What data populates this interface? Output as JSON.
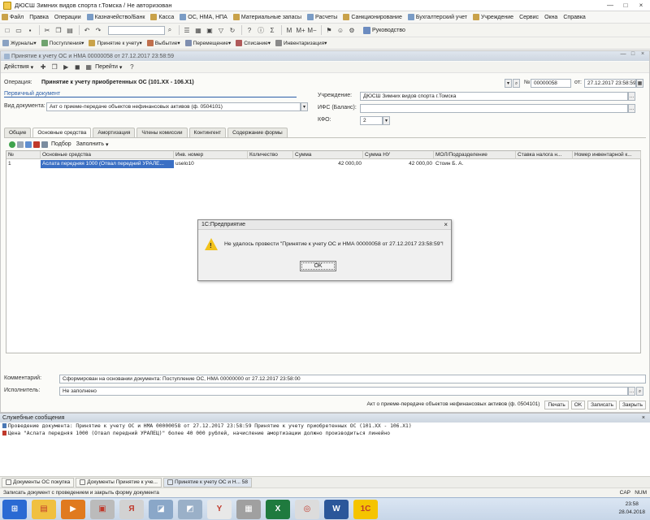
{
  "window": {
    "title": "ДЮСШ Зимних видов спорта г.Томска / Не авторизован",
    "controls": [
      "—",
      "□",
      "×"
    ]
  },
  "menu": [
    {
      "label": "Файл",
      "icon": "file-icon"
    },
    {
      "label": "Правка",
      "icon": null
    },
    {
      "label": "Операции",
      "icon": null
    },
    {
      "label": "Казначейство/Банк",
      "icon": "bank-icon"
    },
    {
      "label": "Касса",
      "icon": "cash-icon"
    },
    {
      "label": "ОС, НМА, НПА",
      "icon": "assets-icon"
    },
    {
      "label": "Материальные запасы",
      "icon": "materials-icon"
    },
    {
      "label": "Расчеты",
      "icon": "calc-icon"
    },
    {
      "label": "Санкционирование",
      "icon": "sanction-icon"
    },
    {
      "label": "Бухгалтерский учет",
      "icon": "ledger-icon"
    },
    {
      "label": "Учреждение",
      "icon": "org-icon"
    },
    {
      "label": "Сервис",
      "icon": null
    },
    {
      "label": "Окна",
      "icon": null
    },
    {
      "label": "Справка",
      "icon": null
    }
  ],
  "toolbar2": [
    {
      "label": "Журналы",
      "icon": "journal-icon"
    },
    {
      "label": "Поступления",
      "icon": "income-icon"
    },
    {
      "label": "Принятие к учету",
      "icon": "accept-icon"
    },
    {
      "label": "Выбытие",
      "icon": "disposal-icon"
    },
    {
      "label": "Перемещение",
      "icon": "move-icon"
    },
    {
      "label": "Списание",
      "icon": "writeoff-icon"
    },
    {
      "label": "Инвентаризация",
      "icon": "inventory-icon"
    }
  ],
  "toolbar1_right": {
    "text": "Руководство",
    "sigma": "Σ",
    "m_btn": "M",
    "mplus": "M+",
    "mminus": "M−"
  },
  "doc": {
    "title": "Принятие к учету ОС и НМА 00000058 от 27.12.2017 23:58:59",
    "toolbar": {
      "actions": "Действия",
      "go": "Перейти",
      "help": "?"
    },
    "operation_label": "Операция:",
    "operation_value": "Принятие к учету приобретенных ОС (101.ХХ - 106.Х1)",
    "number_label": "№",
    "number": "00000058",
    "date_label": "от:",
    "date": "27.12.2017 23:58:59",
    "primary_doc": "Первичный документ",
    "kind_label": "Вид документа:",
    "kind_value": "Акт о приеме-передаче объектов нефинансовых активов (ф. 0504101)",
    "institution_label": "Учреждение:",
    "institution_value": "ДЮСШ Зимних видов спорта г.Томска",
    "ifs_label": "ИФС (Баланс):",
    "ifs_value": "",
    "kfo_label": "КФО:",
    "kfo_value": "2",
    "tabs": [
      "Общие",
      "Основные средства",
      "Амортизация",
      "Члены комиссии",
      "Контингент",
      "Содержание формы"
    ],
    "grid_toolbar": {
      "select": "Подбор",
      "fill": "Заполнить"
    },
    "columns": [
      "№",
      "Основные средства",
      "Инв. номер",
      "Количество",
      "Сумма",
      "Сумма НУ",
      "МОЛ/Подразделение",
      "Ставка налога н...",
      "Номер инвентарной к..."
    ],
    "rows": [
      {
        "n": "1",
        "asset": "Аслата передняя 1000 (Отвал передний УРАЛЕ...",
        "inv": "uselo10",
        "qty": "",
        "sum": "42 000,00",
        "sum_nu": "42 000,00",
        "mol": "Стоин Б. А.",
        "rate": "",
        "card": ""
      }
    ],
    "comment_label": "Комментарий:",
    "comment_value": "Сформирован на основании документа: Поступление ОС, НМА 00000000 от 27.12.2017 23:58:00",
    "executor_label": "Исполнитель:",
    "executor_value": "Не заполнено",
    "bottom_buttons": [
      "Акт о приеме-передаче объектов нефинансовых активов (ф. 0504101)",
      "Печать",
      "OK",
      "Записать",
      "Закрыть"
    ]
  },
  "dialog": {
    "title": "1С:Предприятие",
    "message": "Не удалось провести \"Принятие к учету ОС и НМА 00000058 от 27.12.2017 23:58:59\"!",
    "ok": "OK"
  },
  "messages": {
    "title": "Служебные сообщения",
    "lines": [
      {
        "kind": "info",
        "text": "Проведение документа: Принятие к учету ОС и НМА 00000058 от 27.12.2017 23:58:59 Принятие к учету приобретенных ОС (101.ХХ - 106.Х1)"
      },
      {
        "kind": "error",
        "text": "Цена \"Аслата передняя 1000 (Отвал передний УРАЛЕЦ)\" более 40 000 рублей, начисление амортизации должно производиться линейно"
      }
    ]
  },
  "window_tabs": [
    "Документы ОС покупка",
    "Документы Принятие к уче...",
    "Принятие к учету ОС и Н... 58"
  ],
  "app_status": "Записать документ с проведением и закрыть форму документа",
  "status_right": [
    "CAP",
    "NUM"
  ],
  "taskbar": {
    "time": "23:58",
    "date": "28.04.2018",
    "apps": [
      {
        "name": "start",
        "color": "#2a6ad3",
        "glyph": "⊞"
      },
      {
        "name": "explorer",
        "color": "#f0c040",
        "glyph": "▤"
      },
      {
        "name": "media",
        "color": "#e07a1f",
        "glyph": "▶"
      },
      {
        "name": "app-3",
        "color": "#bbbbbb",
        "glyph": "▣"
      },
      {
        "name": "yandex",
        "color": "#d2d2d2",
        "glyph": "Я"
      },
      {
        "name": "app-5",
        "color": "#8aa7c8",
        "glyph": "◪"
      },
      {
        "name": "app-6",
        "color": "#9ab0c8",
        "glyph": "◩"
      },
      {
        "name": "yandex-browser",
        "color": "#e8e8e8",
        "glyph": "Y"
      },
      {
        "name": "app-8",
        "color": "#a0a0a0",
        "glyph": "▦"
      },
      {
        "name": "excel",
        "color": "#1f7a3e",
        "glyph": "X"
      },
      {
        "name": "chrome",
        "color": "#dcdcdc",
        "glyph": "◎"
      },
      {
        "name": "word",
        "color": "#2b579a",
        "glyph": "W"
      },
      {
        "name": "1c",
        "color": "#f5c400",
        "glyph": "1С"
      }
    ]
  },
  "colors": {
    "accent": "#2b5ea8",
    "warning": "#f2c21b",
    "selection": "#3a6fc4"
  }
}
